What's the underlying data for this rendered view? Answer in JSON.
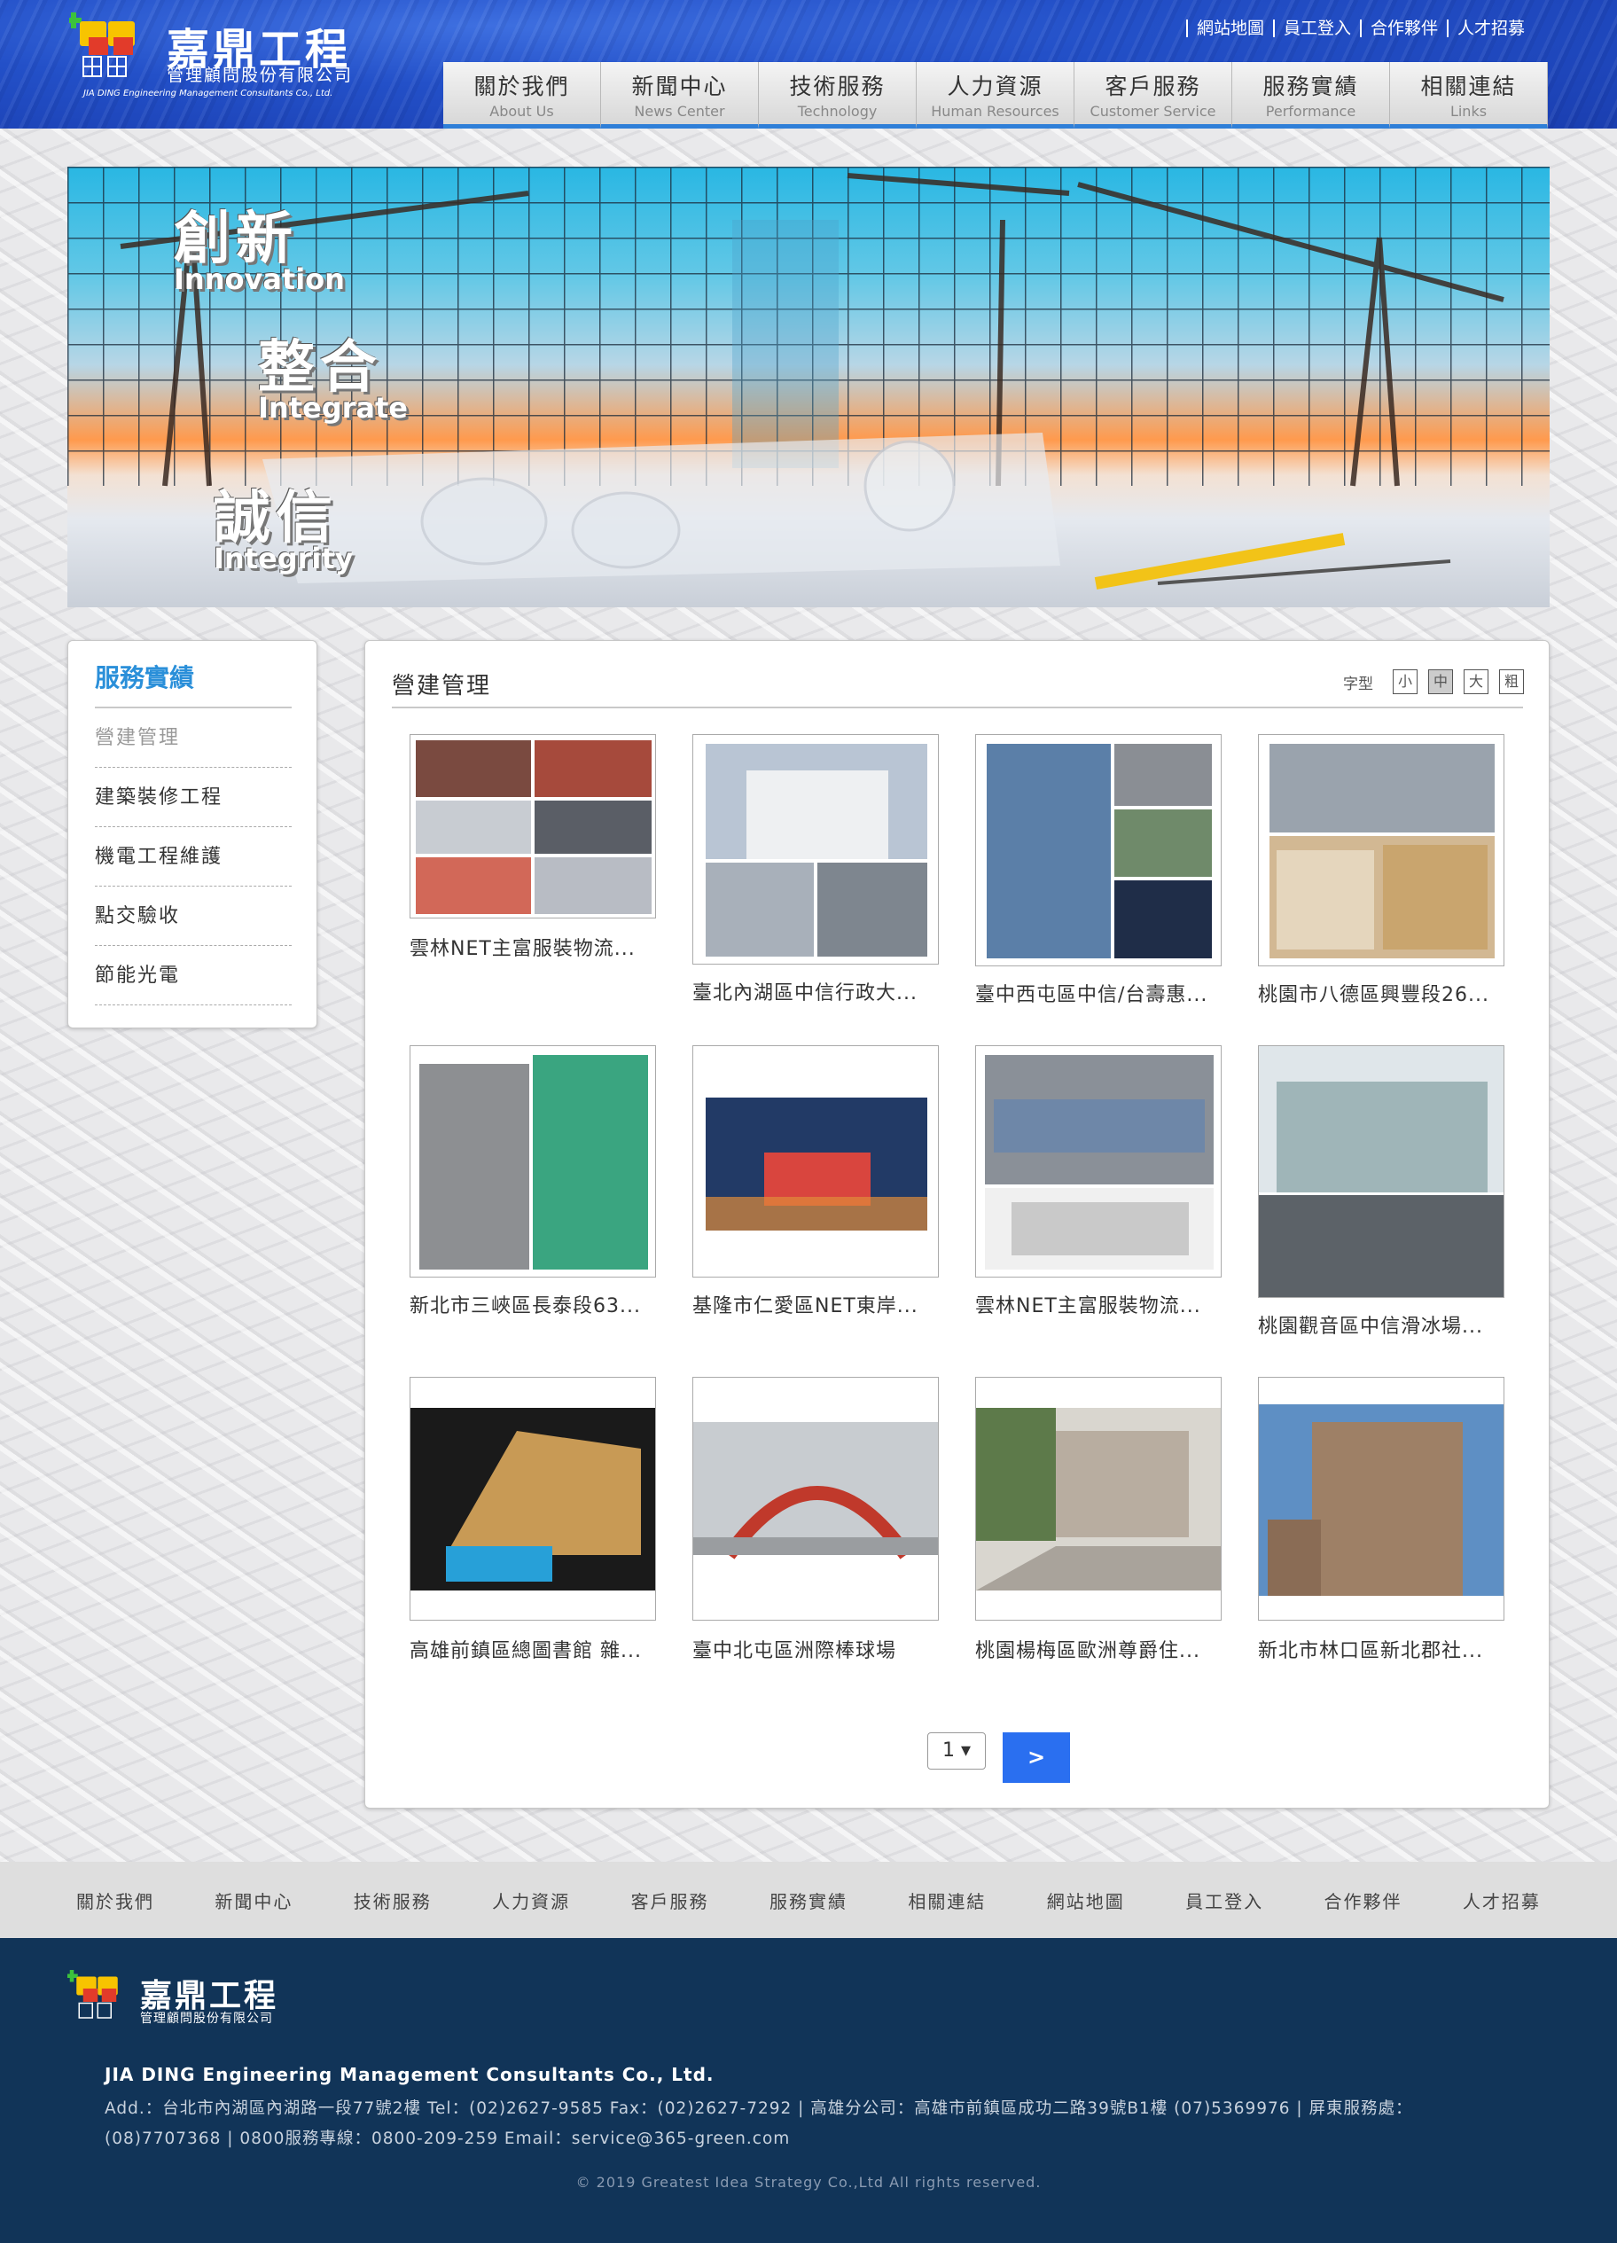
{
  "logo": {
    "cn": "嘉鼎工程",
    "sub": "管理顧問股份有限公司",
    "en": "JIA DING Engineering Management Consultants Co., Ltd."
  },
  "top_links": [
    "網站地圖",
    "員工登入",
    "合作夥伴",
    "人才招募"
  ],
  "nav": [
    {
      "cn": "關於我們",
      "en": "About Us"
    },
    {
      "cn": "新聞中心",
      "en": "News Center"
    },
    {
      "cn": "技術服務",
      "en": "Technology"
    },
    {
      "cn": "人力資源",
      "en": "Human Resources"
    },
    {
      "cn": "客戶服務",
      "en": "Customer Service"
    },
    {
      "cn": "服務實績",
      "en": "Performance"
    },
    {
      "cn": "相關連結",
      "en": "Links"
    }
  ],
  "banner": {
    "slogans": [
      {
        "zh": "創新",
        "en": "Innovation"
      },
      {
        "zh": "整合",
        "en": "Integrate"
      },
      {
        "zh": "誠信",
        "en": "Integrity"
      }
    ]
  },
  "sidebar": {
    "title": "服務實績",
    "items": [
      "營建管理",
      "建築裝修工程",
      "機電工程維護",
      "點交驗收",
      "節能光電"
    ],
    "active_index": 0
  },
  "main": {
    "title": "營建管理",
    "font_label": "字型",
    "font_options": [
      "小",
      "中",
      "大",
      "粗"
    ],
    "font_selected": "中",
    "projects": [
      "雲林NET主富服裝物流...",
      "臺北內湖區中信行政大...",
      "臺中西屯區中信/台壽惠...",
      "桃園市八德區興豐段26...",
      "新北市三峽區長泰段63...",
      "基隆市仁愛區NET東岸...",
      "雲林NET主富服裝物流...",
      "桃園觀音區中信滑冰場...",
      "高雄前鎮區總圖書館 雜...",
      "臺中北屯區洲際棒球場",
      "桃園楊梅區歐洲尊爵住...",
      "新北市林口區新北郡社..."
    ],
    "pager": {
      "current": "1",
      "next": ">"
    }
  },
  "footer_nav": [
    "關於我們",
    "新聞中心",
    "技術服務",
    "人力資源",
    "客戶服務",
    "服務實績",
    "相關連結",
    "網站地圖",
    "員工登入",
    "合作夥伴",
    "人才招募"
  ],
  "footer": {
    "logo_cn": "嘉鼎工程",
    "logo_sub": "管理顧問股份有限公司",
    "company": "JIA DING Engineering Management Consultants Co., Ltd.",
    "address": "Add.：台北市內湖區內湖路一段77號2樓 Tel：(02)2627-9585 Fax：(02)2627-7292 | 高雄分公司：高雄市前鎮區成功二路39號B1樓 (07)5369976 | 屏東服務處：(08)7707368 | 0800服務專線：0800-209-259 Email：service@365-green.com",
    "copyright": "© 2019 Greatest Idea Strategy Co.,Ltd All rights reserved."
  }
}
